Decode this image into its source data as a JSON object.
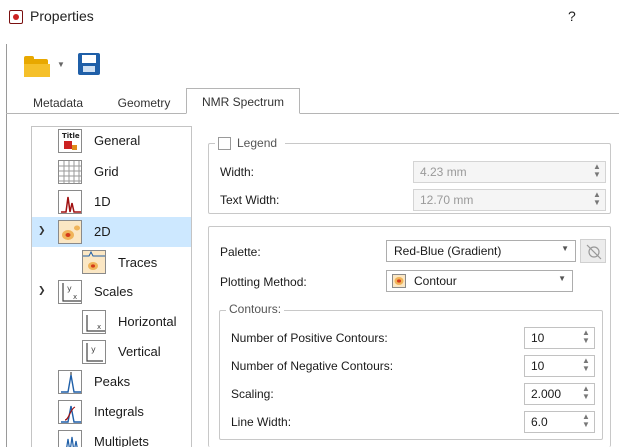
{
  "window": {
    "title": "Properties",
    "help": "?"
  },
  "toolbar": {
    "open_icon": "folder-icon",
    "save_icon": "floppy-disk-icon"
  },
  "tabs": [
    {
      "label": "Metadata",
      "active": false
    },
    {
      "label": "Geometry",
      "active": false
    },
    {
      "label": "NMR Spectrum",
      "active": true
    }
  ],
  "tree": {
    "items": [
      {
        "label": "General",
        "icon": "title-icon"
      },
      {
        "label": "Grid",
        "icon": "grid-icon"
      },
      {
        "label": "1D",
        "icon": "1d-spectrum-icon"
      },
      {
        "label": "2D",
        "icon": "2d-contour-icon",
        "expanded": true,
        "selected": true
      },
      {
        "label": "Traces",
        "icon": "traces-icon"
      },
      {
        "label": "Scales",
        "icon": "scales-icon",
        "expanded": true
      },
      {
        "label": "Horizontal",
        "icon": "horizontal-scale-icon"
      },
      {
        "label": "Vertical",
        "icon": "vertical-scale-icon"
      },
      {
        "label": "Peaks",
        "icon": "peaks-icon"
      },
      {
        "label": "Integrals",
        "icon": "integrals-icon"
      },
      {
        "label": "Multiplets",
        "icon": "multiplets-icon"
      }
    ]
  },
  "legend": {
    "title": "Legend",
    "checked": false,
    "width_label": "Width:",
    "width_value": "4.23 mm",
    "text_width_label": "Text Width:",
    "text_width_value": "12.70 mm"
  },
  "display": {
    "palette_label": "Palette:",
    "palette_value": "Red-Blue (Gradient)",
    "plotting_method_label": "Plotting Method:",
    "plotting_method_value": "Contour",
    "contours_title": "Contours:",
    "positive_label": "Number of Positive Contours:",
    "positive_value": "10",
    "negative_label": "Number of Negative Contours:",
    "negative_value": "10",
    "scaling_label": "Scaling:",
    "scaling_value": "2.000",
    "line_width_label": "Line Width:",
    "line_width_value": "6.0"
  },
  "colors": {
    "selection": "#cde8ff",
    "save_blue": "#1f5fa8",
    "folder_yellow": "#f5c02a"
  }
}
